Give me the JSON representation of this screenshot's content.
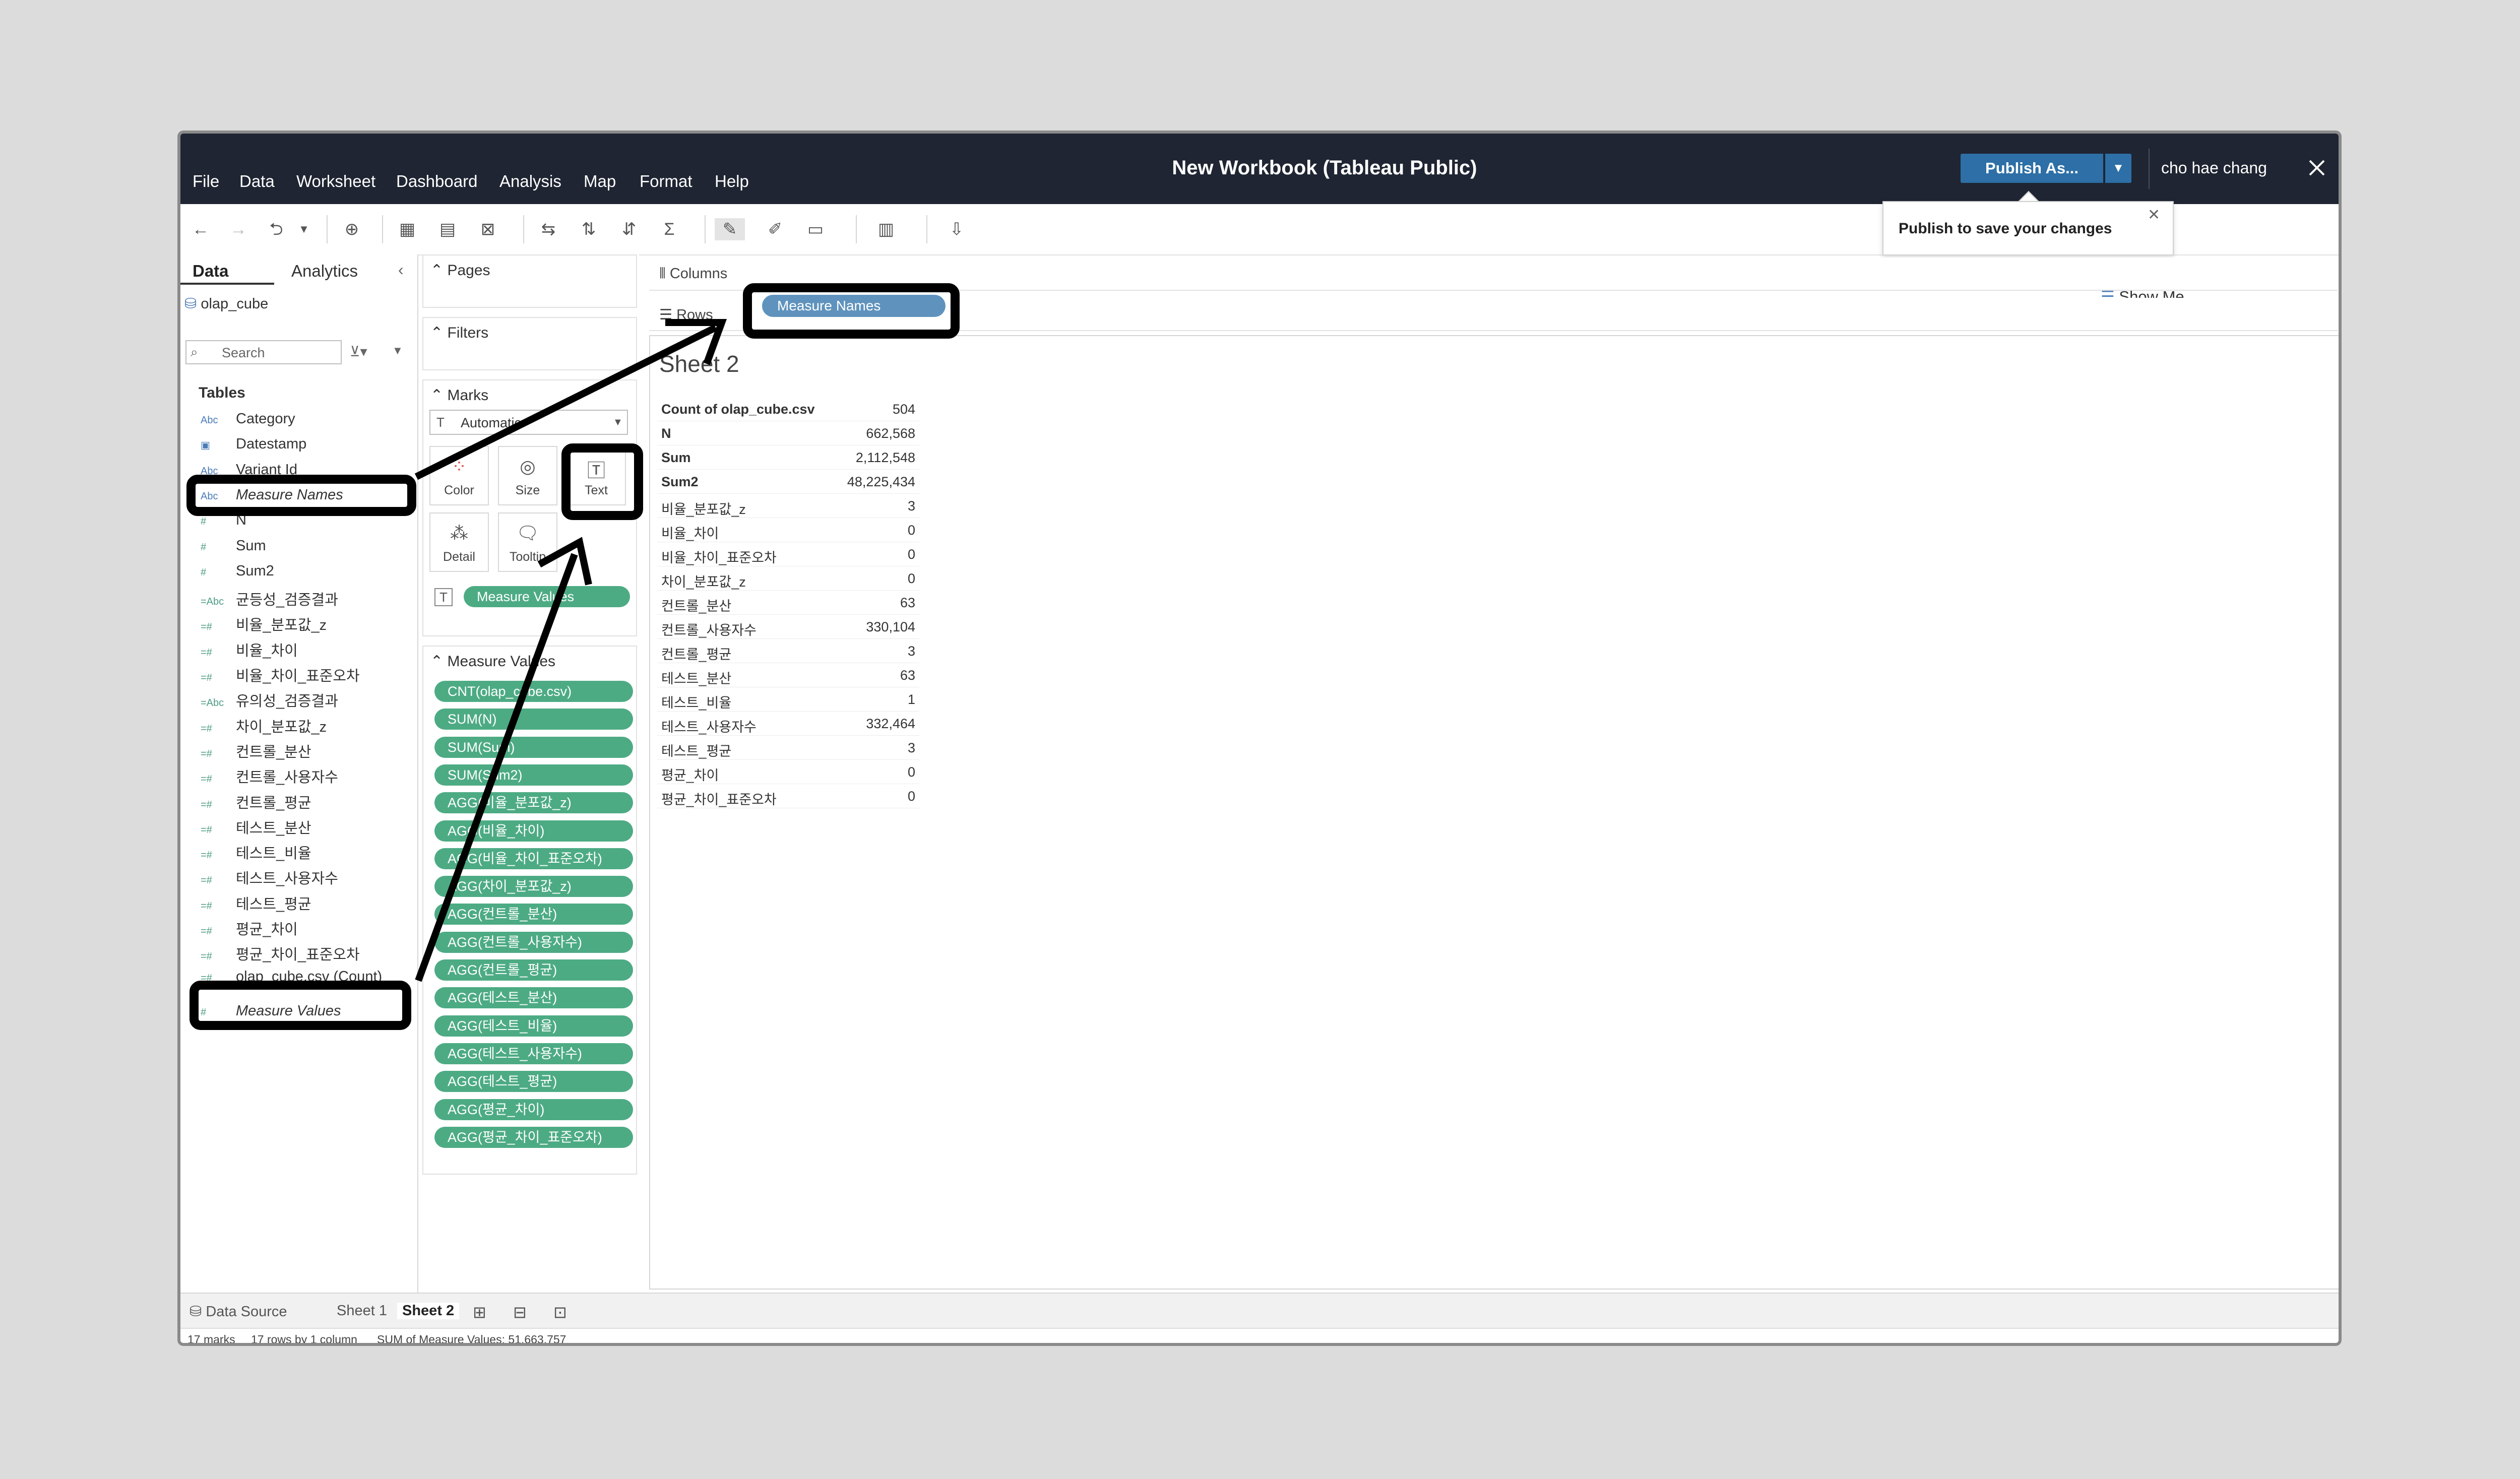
{
  "window": {
    "title": "New Workbook (Tableau Public)",
    "publish_label": "Publish As...",
    "user": "cho hae chang",
    "publish_tooltip": "Publish to save your changes",
    "show_me": "Show Me"
  },
  "menu": [
    "File",
    "Data",
    "Worksheet",
    "Dashboard",
    "Analysis",
    "Map",
    "Format",
    "Help"
  ],
  "data_pane": {
    "tabs": [
      "Data",
      "Analytics"
    ],
    "source": "olap_cube",
    "search_placeholder": "Search",
    "tables_header": "Tables",
    "fields": [
      {
        "type": "Abc",
        "name": "Category"
      },
      {
        "type": "date",
        "name": "Datestamp"
      },
      {
        "type": "Abc",
        "name": "Variant Id"
      },
      {
        "type": "Abc",
        "name": "Measure Names"
      },
      {
        "type": "#",
        "name": "N"
      },
      {
        "type": "#",
        "name": "Sum"
      },
      {
        "type": "#",
        "name": "Sum2"
      },
      {
        "type": "=Abc",
        "name": "균등성_검증결과"
      },
      {
        "type": "=#",
        "name": "비율_분포값_z"
      },
      {
        "type": "=#",
        "name": "비율_차이"
      },
      {
        "type": "=#",
        "name": "비율_차이_표준오차"
      },
      {
        "type": "=Abc",
        "name": "유의성_검증결과"
      },
      {
        "type": "=#",
        "name": "차이_분포값_z"
      },
      {
        "type": "=#",
        "name": "컨트롤_분산"
      },
      {
        "type": "=#",
        "name": "컨트롤_사용자수"
      },
      {
        "type": "=#",
        "name": "컨트롤_평균"
      },
      {
        "type": "=#",
        "name": "테스트_분산"
      },
      {
        "type": "=#",
        "name": "테스트_비율"
      },
      {
        "type": "=#",
        "name": "테스트_사용자수"
      },
      {
        "type": "=#",
        "name": "테스트_평균"
      },
      {
        "type": "=#",
        "name": "평균_차이"
      },
      {
        "type": "=#",
        "name": "평균_차이_표준오차"
      },
      {
        "type": "=#",
        "name": "olap_cube.csv (Count)"
      },
      {
        "type": "#",
        "name": "Measure Values"
      }
    ]
  },
  "cards": {
    "pages": "Pages",
    "filters": "Filters",
    "marks": "Marks",
    "mark_type": "Automatic",
    "mark_buttons": [
      "Color",
      "Size",
      "Text",
      "Detail",
      "Tooltip"
    ],
    "marks_pill": "Measure Values",
    "measure_values_title": "Measure Values",
    "measure_values": [
      "CNT(olap_cube.csv)",
      "SUM(N)",
      "SUM(Sum)",
      "SUM(Sum2)",
      "AGG(비율_분포값_z)",
      "AGG(비율_차이)",
      "AGG(비율_차이_표준오차)",
      "AGG(차이_분포값_z)",
      "AGG(컨트롤_분산)",
      "AGG(컨트롤_사용자수)",
      "AGG(컨트롤_평균)",
      "AGG(테스트_분산)",
      "AGG(테스트_비율)",
      "AGG(테스트_사용자수)",
      "AGG(테스트_평균)",
      "AGG(평균_차이)",
      "AGG(평균_차이_표준오차)"
    ]
  },
  "shelves": {
    "columns": "Columns",
    "rows": "Rows",
    "rows_pill": "Measure Names"
  },
  "view": {
    "sheet_title": "Sheet 2",
    "rows": [
      {
        "label": "Count of olap_cube.csv",
        "value": "504"
      },
      {
        "label": "N",
        "value": "662,568"
      },
      {
        "label": "Sum",
        "value": "2,112,548"
      },
      {
        "label": "Sum2",
        "value": "48,225,434"
      },
      {
        "label": "비율_분포값_z",
        "value": "3"
      },
      {
        "label": "비율_차이",
        "value": "0"
      },
      {
        "label": "비율_차이_표준오차",
        "value": "0"
      },
      {
        "label": "차이_분포값_z",
        "value": "0"
      },
      {
        "label": "컨트롤_분산",
        "value": "63"
      },
      {
        "label": "컨트롤_사용자수",
        "value": "330,104"
      },
      {
        "label": "컨트롤_평균",
        "value": "3"
      },
      {
        "label": "테스트_분산",
        "value": "63"
      },
      {
        "label": "테스트_비율",
        "value": "1"
      },
      {
        "label": "테스트_사용자수",
        "value": "332,464"
      },
      {
        "label": "테스트_평균",
        "value": "3"
      },
      {
        "label": "평균_차이",
        "value": "0"
      },
      {
        "label": "평균_차이_표준오차",
        "value": "0"
      }
    ]
  },
  "bottom": {
    "data_source": "Data Source",
    "sheets": [
      "Sheet 1",
      "Sheet 2"
    ],
    "status": [
      "17 marks",
      "17 rows by 1 column",
      "SUM of Measure Values: 51,663,757"
    ]
  },
  "colors": {
    "titlebar": "#1f2532",
    "publish": "#2d6fa6",
    "measure_pill": "#4dab84",
    "dimension_pill": "#5f93bd"
  }
}
